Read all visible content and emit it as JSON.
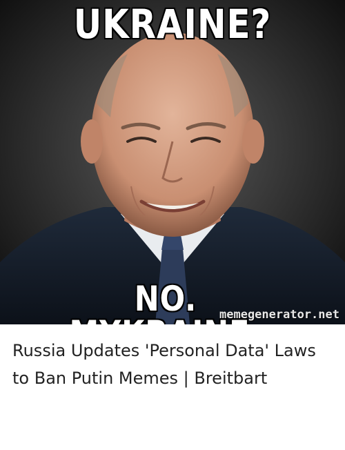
{
  "meme": {
    "top_text": "UKRAINE?",
    "bottom_text": "NO. MYKRAINE.",
    "watermark": "memegenerator.net",
    "photo": "smiling-man-portrait"
  },
  "article": {
    "headline": "Russia Updates 'Personal Data' Laws to Ban Putin Memes | Breitbart"
  },
  "colors": {
    "background": "#000000",
    "caption_text": "#ffffff",
    "headline_text": "#222222",
    "page_background": "#ffffff"
  }
}
